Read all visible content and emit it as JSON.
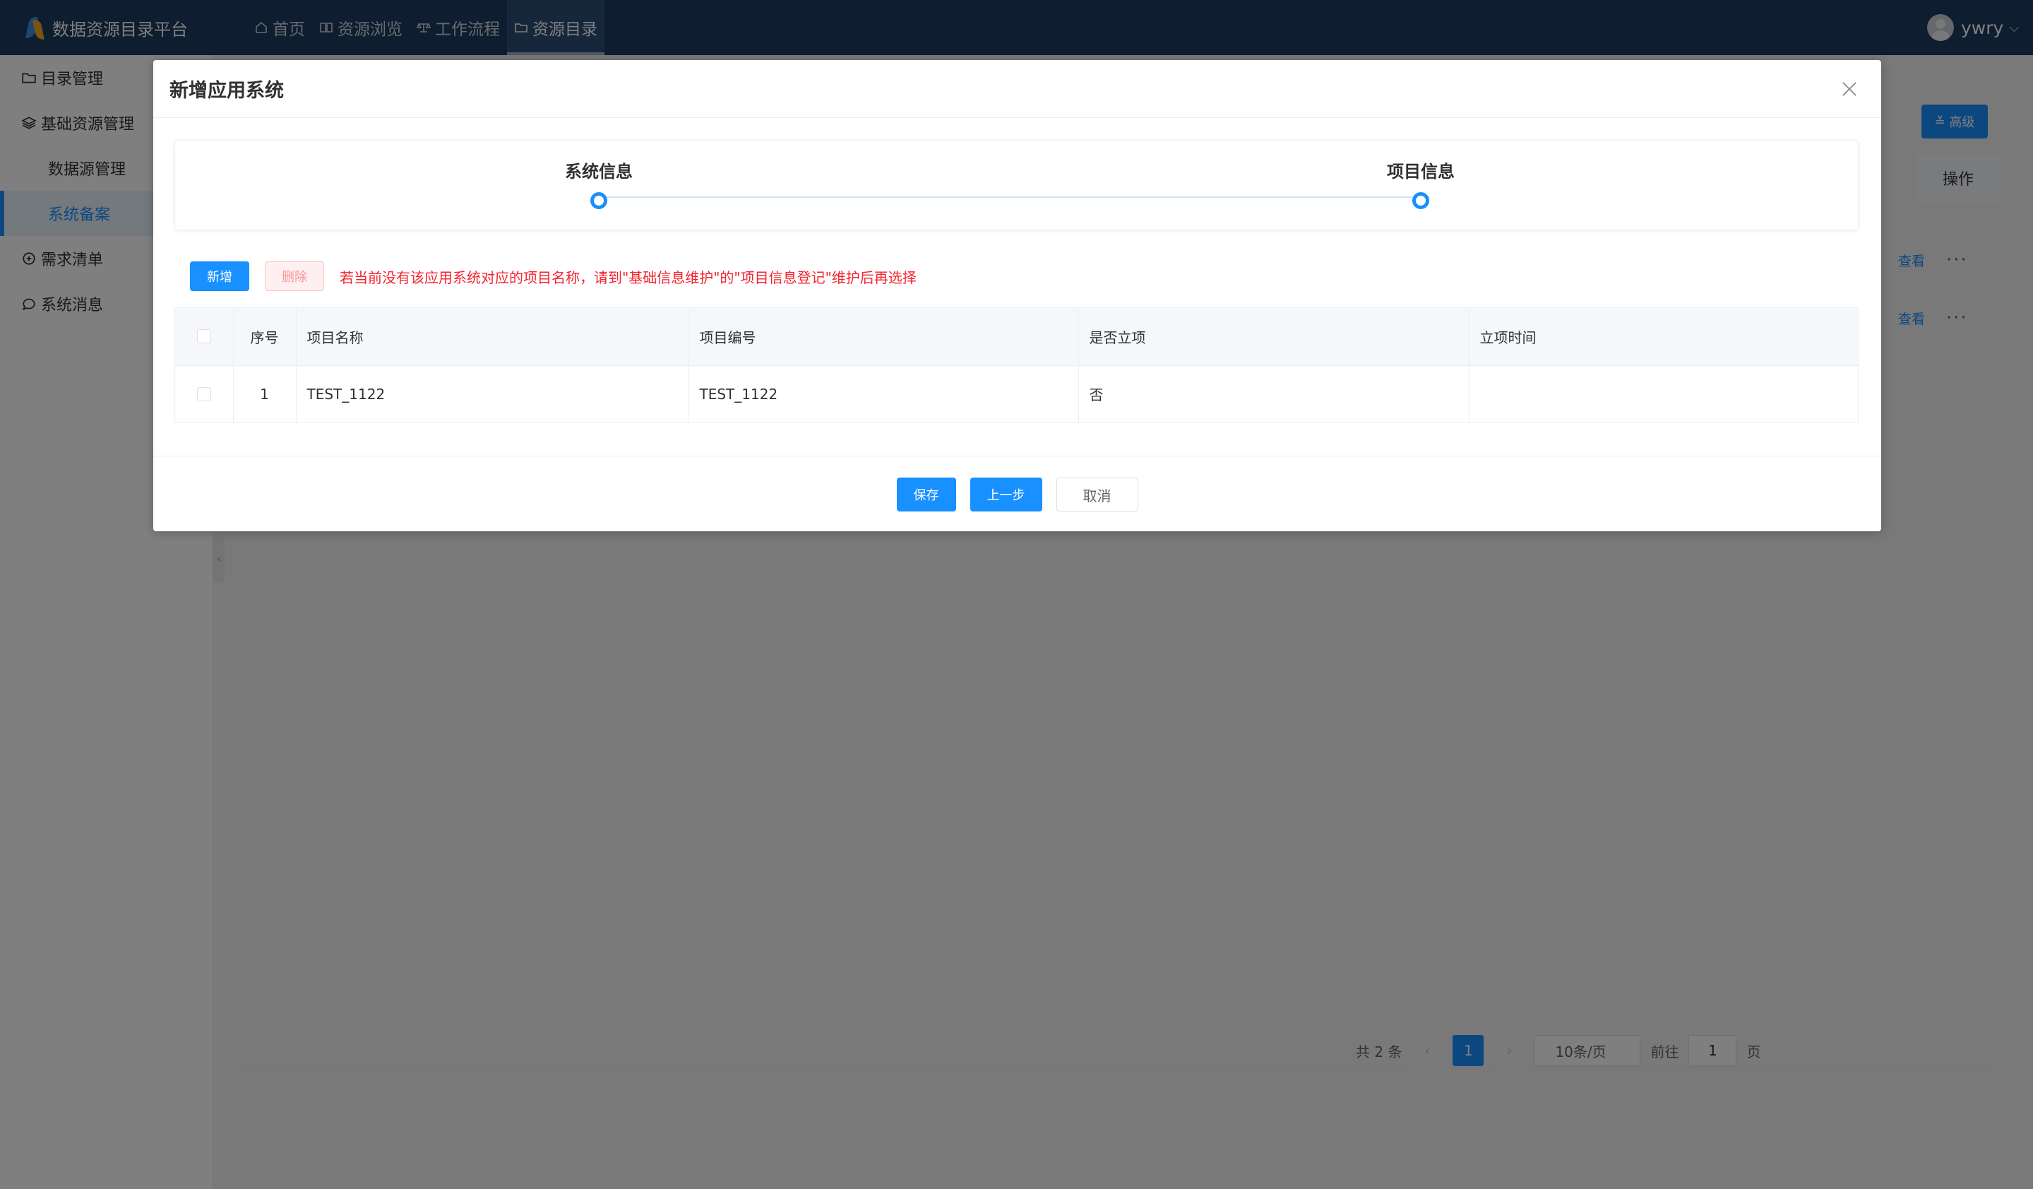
{
  "app": {
    "title": "数据资源目录平台"
  },
  "nav": {
    "items": [
      {
        "label": "首页",
        "icon": "home-icon"
      },
      {
        "label": "资源浏览",
        "icon": "book-icon"
      },
      {
        "label": "工作流程",
        "icon": "workflow-icon"
      },
      {
        "label": "资源目录",
        "icon": "folder-icon",
        "active": true
      }
    ]
  },
  "user": {
    "name": "ywry"
  },
  "sidebar": {
    "items": [
      {
        "label": "目录管理",
        "icon": "folder-icon"
      },
      {
        "label": "基础资源管理",
        "icon": "layers-icon"
      },
      {
        "label": "数据源管理"
      },
      {
        "label": "系统备案",
        "active": true
      },
      {
        "label": "需求清单",
        "icon": "demand-icon"
      },
      {
        "label": "系统消息",
        "icon": "message-icon"
      }
    ]
  },
  "background": {
    "advanced_label": "高级",
    "operation_header": "操作",
    "rows": [
      {
        "view_label": "查看",
        "more_label": "···"
      },
      {
        "view_label": "查看",
        "more_label": "···"
      }
    ],
    "pager": {
      "total": "共 2 条",
      "current_page": "1",
      "page_size": "10条/页",
      "goto_label": "前往",
      "goto_value": "1",
      "page_suffix": "页"
    }
  },
  "dialog": {
    "title": "新增应用系统",
    "steps": [
      {
        "label": "系统信息"
      },
      {
        "label": "项目信息"
      }
    ],
    "toolbar": {
      "add_label": "新增",
      "delete_label": "删除",
      "hint": "若当前没有该应用系统对应的项目名称，请到\"基础信息维护\"的\"项目信息登记\"维护后再选择"
    },
    "table": {
      "columns": [
        "序号",
        "项目名称",
        "项目编号",
        "是否立项",
        "立项时间"
      ],
      "rows": [
        {
          "index": "1",
          "name": "TEST_1122",
          "code": "TEST_1122",
          "approved": "否",
          "approved_time": ""
        }
      ]
    },
    "footer": {
      "save_label": "保存",
      "prev_label": "上一步",
      "cancel_label": "取消"
    }
  },
  "colors": {
    "topbar": "#1d3a5f",
    "primary": "#1890ff",
    "danger": "#f5222d"
  }
}
